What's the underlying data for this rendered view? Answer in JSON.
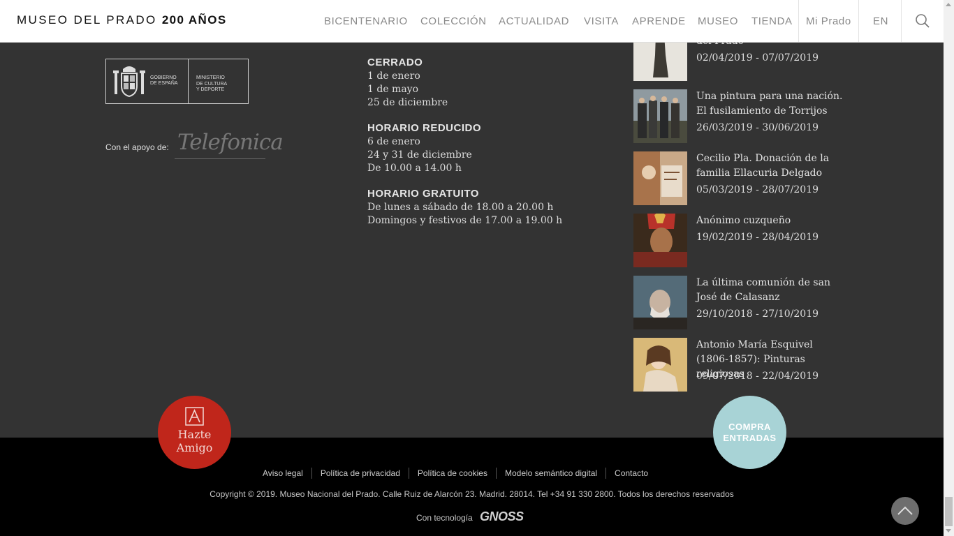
{
  "header": {
    "logo_main": "MUSEO DEL PRADO",
    "logo_bold": "200 AÑOS",
    "nav": [
      "BICENTENARIO",
      "COLECCIÓN",
      "ACTUALIDAD",
      "VISITA",
      "APRENDE",
      "MUSEO",
      "TIENDA"
    ],
    "mi_prado": "Mi Prado",
    "lang": "EN",
    "search_icon": "search-icon"
  },
  "sponsors": {
    "gov_text_1": "GOBIERNO",
    "gov_text_2": "DE ESPAÑA",
    "ministry_1": "MINISTERIO",
    "ministry_2": "DE CULTURA",
    "ministry_3": "Y DEPORTE",
    "support_label": "Con el apoyo de:",
    "telefonica": "Telefonica"
  },
  "hours": {
    "closed_title": "CERRADO",
    "closed_lines": [
      "1 de enero",
      "1 de mayo",
      "25 de diciembre"
    ],
    "reduced_title": "HORARIO REDUCIDO",
    "reduced_lines": [
      "6 de enero",
      "24 y 31 de diciembre",
      "De 10.00 a 14.00 h"
    ],
    "free_title": "HORARIO GRATUITO",
    "free_lines": [
      "De lunes a sábado de 18.00 a 20.00 h",
      "Domingos y festivos de 17.00 a 19.00 h"
    ]
  },
  "exhibitions": [
    {
      "title": "del Prado",
      "dates": "02/04/2019 - 07/07/2019"
    },
    {
      "title": "Una pintura para una nación. El fusilamiento de Torrijos",
      "dates": "26/03/2019 - 30/06/2019"
    },
    {
      "title": "Cecilio Pla. Donación de la familia Ellacuria Delgado",
      "dates": "05/03/2019 - 28/07/2019"
    },
    {
      "title": "Anónimo cuzqueño",
      "dates": "19/02/2019 - 28/04/2019"
    },
    {
      "title": "La última comunión de san José de Calasanz",
      "dates": "29/10/2018 - 27/10/2019"
    },
    {
      "title": "Antonio María Esquivel (1806-1857): Pinturas religiosas",
      "dates": "09/07/2018 - 22/04/2019"
    }
  ],
  "circles": {
    "friend_line1": "Hazte",
    "friend_line2": "Amigo",
    "buy_line1": "COMPRA",
    "buy_line2": "ENTRADAS"
  },
  "footer": {
    "links": [
      "Aviso legal",
      "Política de privacidad",
      "Política de cookies",
      "Modelo semántico digital",
      "Contacto"
    ],
    "copyright": "Copyright © 2019. Museo Nacional del Prado. Calle Ruiz de Alarcón 23. Madrid. 28014. Tel +34 91 330 2800. Todos los derechos reservados",
    "tech_label": "Con tecnología",
    "tech_brand": "GNOSS"
  },
  "colors": {
    "accent_red": "#c0261b",
    "accent_teal": "#a8d3d6",
    "background": "#333333",
    "footer_bg": "#000000"
  }
}
